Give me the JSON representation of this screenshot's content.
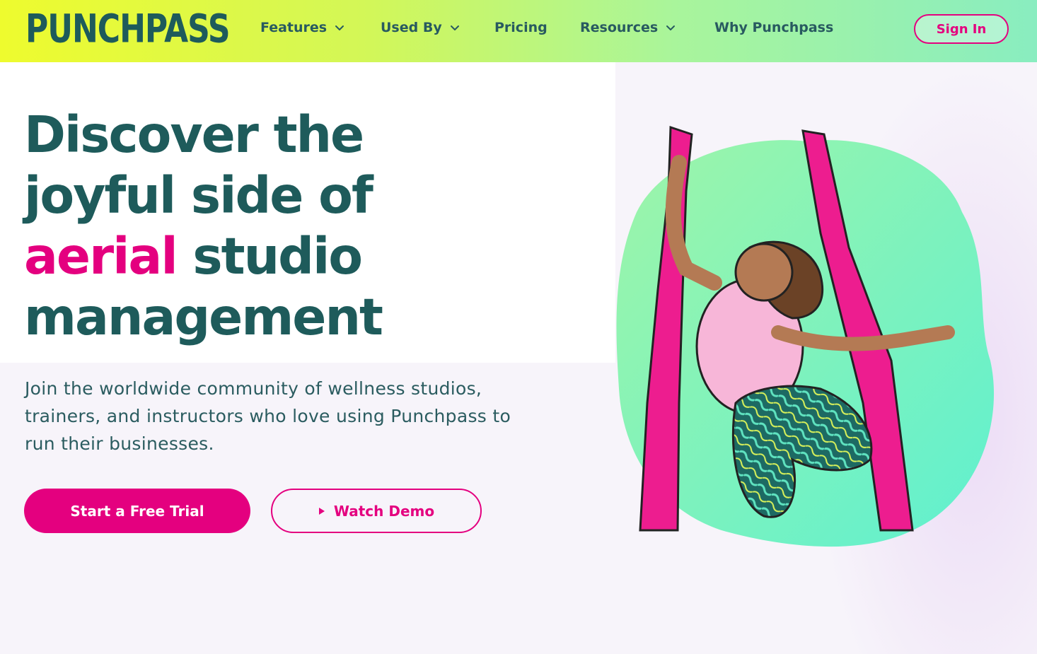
{
  "brand": {
    "logo_text": "PUNCHPASS"
  },
  "nav": {
    "items": [
      {
        "label": "Features",
        "has_dropdown": true
      },
      {
        "label": "Used By",
        "has_dropdown": true
      },
      {
        "label": "Pricing",
        "has_dropdown": false
      },
      {
        "label": "Resources",
        "has_dropdown": true
      },
      {
        "label": "Why Punchpass",
        "has_dropdown": false
      }
    ],
    "sign_in_label": "Sign In"
  },
  "hero": {
    "headline_part1": "Discover the joyful side of ",
    "headline_accent": "aerial",
    "headline_part2": " studio management",
    "subtext": "Join the worldwide community of wellness studios, trainers, and instructors who love using Punchpass to run their businesses.",
    "primary_cta": "Start a Free Trial",
    "secondary_cta": "Watch Demo"
  },
  "colors": {
    "brand_teal": "#1e5b5b",
    "accent_pink": "#e4007f",
    "blob_green": "#7ff5c0"
  },
  "icons": [
    "chevron-down-icon",
    "play-icon"
  ]
}
